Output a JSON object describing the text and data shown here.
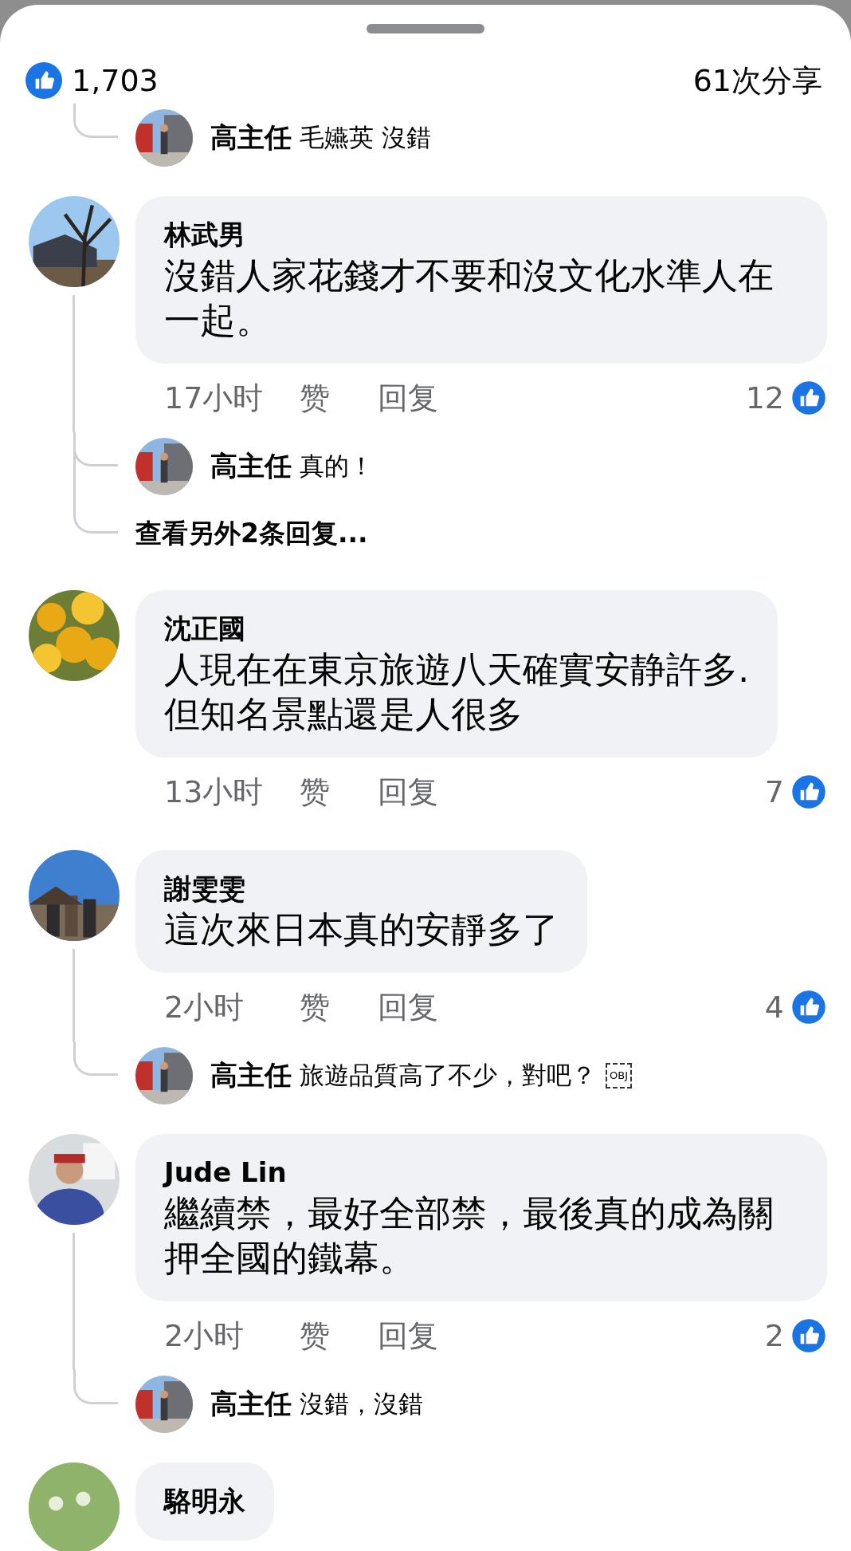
{
  "reactions": {
    "likes": "1,703",
    "shares": "61次分享"
  },
  "threads": [
    {
      "replies": [
        {
          "author": "高主任",
          "text": "毛嬿英 沒錯"
        }
      ]
    },
    {
      "comment": {
        "author": "林武男",
        "text": "沒錯人家花錢才不要和沒文化水準人在一起。",
        "time": "17小时",
        "like": "赞",
        "reply": "回复",
        "likes": "12"
      },
      "replies": [
        {
          "author": "高主任",
          "text": "真的！"
        }
      ],
      "more": "查看另外2条回复..."
    },
    {
      "comment": {
        "author": "沈正國",
        "text": "人現在在東京旅遊八天確實安静許多.\n但知名景點還是人很多",
        "time": "13小时",
        "like": "赞",
        "reply": "回复",
        "likes": "7"
      }
    },
    {
      "comment": {
        "author": "謝雯雯",
        "text": "這次來日本真的安靜多了",
        "time": "2小时",
        "like": "赞",
        "reply": "回复",
        "likes": "4"
      },
      "replies": [
        {
          "author": "高主任",
          "text": "旅遊品質高了不少，對吧？",
          "badge": "OBJ"
        }
      ]
    },
    {
      "comment": {
        "author": "Jude Lin",
        "text": "繼續禁，最好全部禁，最後真的成為關押全國的鐵幕。",
        "time": "2小时",
        "like": "赞",
        "reply": "回复",
        "likes": "2"
      },
      "replies": [
        {
          "author": "高主任",
          "text": "沒錯，沒錯"
        }
      ]
    },
    {
      "comment": {
        "author": "駱明永"
      }
    }
  ]
}
